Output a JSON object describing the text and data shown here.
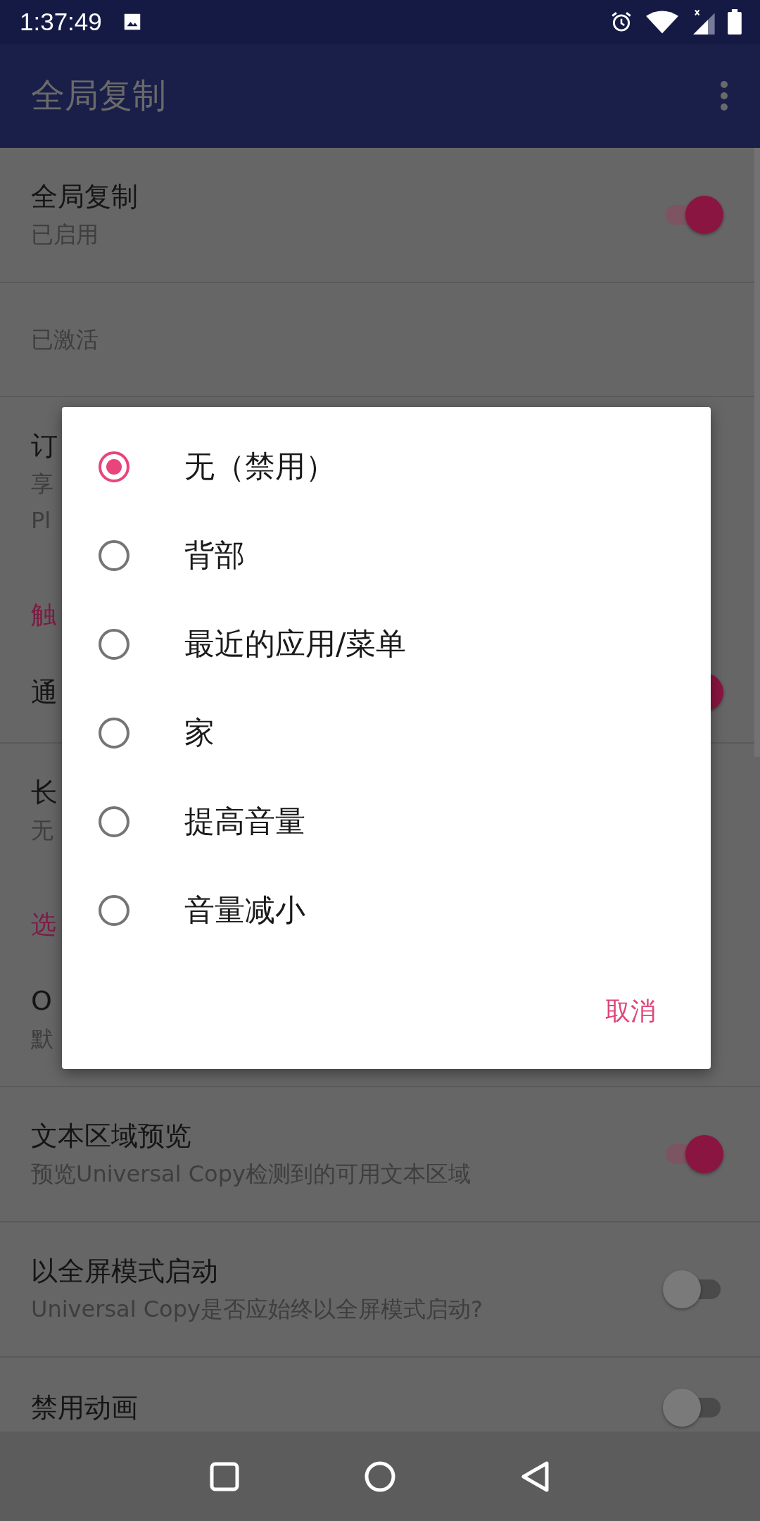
{
  "status_bar": {
    "time": "1:37:49"
  },
  "app_bar": {
    "title": "全局复制"
  },
  "settings": [
    {
      "kind": "row",
      "title": "全局复制",
      "summary": "已启用",
      "switch": {
        "on": true
      }
    },
    {
      "kind": "note",
      "summary": "已激活"
    },
    {
      "kind": "row",
      "title": "订",
      "summary": "享",
      "summary_2": "Pl"
    },
    {
      "kind": "header",
      "title": "触"
    },
    {
      "kind": "row",
      "title": "通",
      "switch": {
        "on": true
      }
    },
    {
      "kind": "row",
      "title": "长",
      "summary": "无"
    },
    {
      "kind": "header",
      "title": "选"
    },
    {
      "kind": "row",
      "title": "O",
      "summary": "默"
    },
    {
      "kind": "row",
      "title": "文本区域预览",
      "summary": "预览Universal Copy检测到的可用文本区域",
      "switch": {
        "on": true
      }
    },
    {
      "kind": "row",
      "title": "以全屏模式启动",
      "summary": "Universal Copy是否应始终以全屏模式启动?",
      "switch": {
        "on": false
      }
    },
    {
      "kind": "row",
      "title": "禁用动画",
      "switch": {
        "on": false
      }
    }
  ],
  "dialog": {
    "options": [
      {
        "label": "无（禁用）",
        "selected": true
      },
      {
        "label": "背部",
        "selected": false
      },
      {
        "label": "最近的应用/菜单",
        "selected": false
      },
      {
        "label": "家",
        "selected": false
      },
      {
        "label": "提高音量",
        "selected": false
      },
      {
        "label": "音量减小",
        "selected": false
      }
    ],
    "cancel": "取消"
  }
}
